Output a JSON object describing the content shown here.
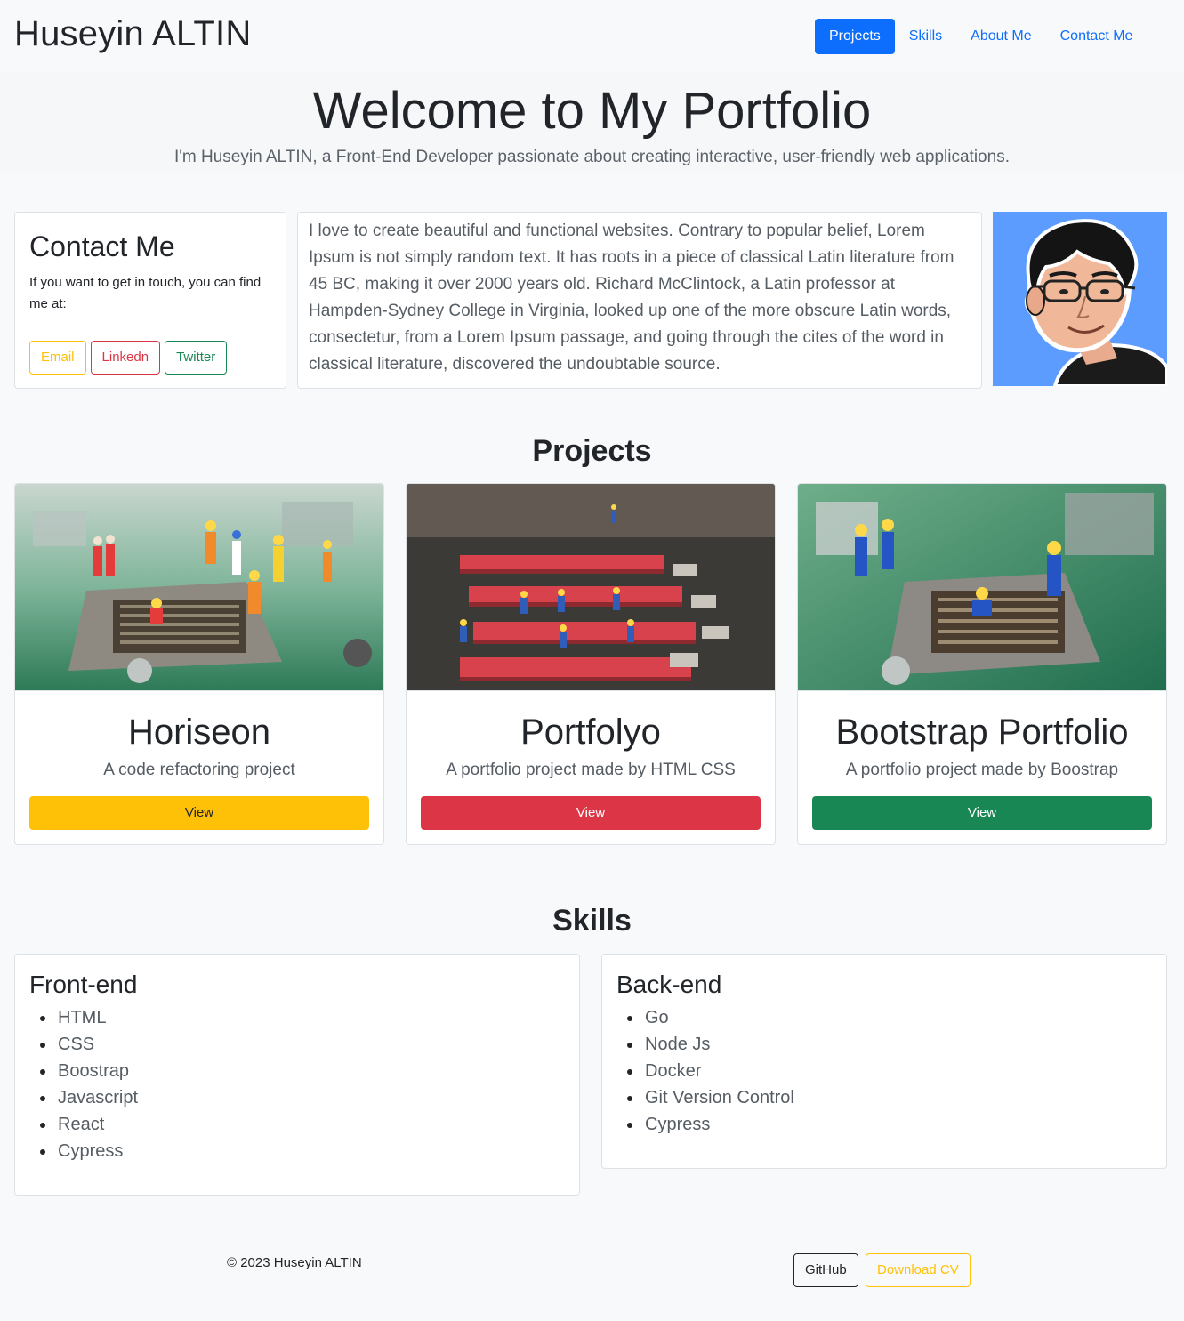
{
  "brand": "Huseyin ALTIN",
  "nav": [
    {
      "label": "Projects",
      "active": true
    },
    {
      "label": "Skills",
      "active": false
    },
    {
      "label": "About Me",
      "active": false
    },
    {
      "label": "Contact Me",
      "active": false
    }
  ],
  "hero": {
    "title": "Welcome to My Portfolio",
    "subtitle": "I'm Huseyin ALTIN, a Front-End Developer passionate about creating interactive, user-friendly web applications."
  },
  "contact": {
    "title": "Contact Me",
    "text": "If you want to get in touch, you can find me at:",
    "buttons": [
      "Email",
      "Linkedn",
      "Twitter"
    ]
  },
  "about": {
    "text": "I love to create beautiful and functional websites. Contrary to popular belief, Lorem Ipsum is not simply random text. It has roots in a piece of classical Latin literature from 45 BC, making it over 2000 years old. Richard McClintock, a Latin professor at Hampden-Sydney College in Virginia, looked up one of the more obscure Latin words, consectetur, from a Lorem Ipsum passage, and going through the cites of the word in classical literature, discovered the undoubtable source."
  },
  "projects": {
    "title": "Projects",
    "items": [
      {
        "name": "Horiseon",
        "desc": "A code refactoring project",
        "button": "View",
        "color": "#ffc107"
      },
      {
        "name": "Portfolyo",
        "desc": "A portfolio project made by HTML CSS",
        "button": "View",
        "color": "#dc3545"
      },
      {
        "name": "Bootstrap Portfolio",
        "desc": "A portfolio project made by Boostrap",
        "button": "View",
        "color": "#198754"
      }
    ]
  },
  "skills": {
    "title": "Skills",
    "frontend": {
      "title": "Front-end",
      "items": [
        "HTML",
        "CSS",
        "Boostrap",
        "Javascript",
        "React",
        "Cypress"
      ]
    },
    "backend": {
      "title": "Back-end",
      "items": [
        "Go",
        "Node Js",
        "Docker",
        "Git Version Control",
        "Cypress"
      ]
    }
  },
  "footer": {
    "copyright": "© 2023 Huseyin ALTIN",
    "github": "GitHub",
    "cv": "Download CV"
  }
}
